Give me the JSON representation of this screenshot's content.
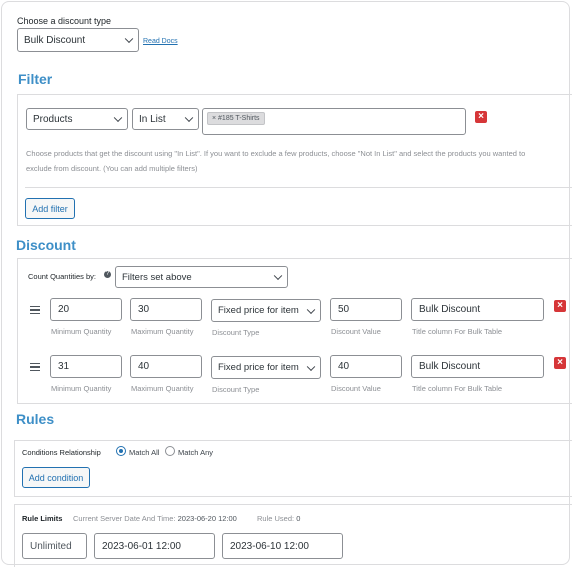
{
  "discount_type": {
    "label": "Choose a discount type",
    "selected": "Bulk Discount",
    "read_docs": "Read Docs"
  },
  "filter": {
    "heading": "Filter",
    "type": "Products",
    "method": "In List",
    "tag": "× #185 T-Shirts",
    "help_line1": "Choose products that get the discount using \"In List\". If you want to exclude a few products, choose \"Not In List\" and select the products you wanted to",
    "help_line2": "exclude from discount. (You can add multiple filters)",
    "add_label": "Add filter"
  },
  "discount": {
    "heading": "Discount",
    "count_label": "Count Quantities by:",
    "count_value": "Filters set above",
    "ranges": [
      {
        "min": "20",
        "max": "30",
        "type": "Fixed price for item",
        "value": "50",
        "title": "Bulk Discount"
      },
      {
        "min": "31",
        "max": "40",
        "type": "Fixed price for item",
        "value": "40",
        "title": "Bulk Discount"
      }
    ],
    "captions": {
      "min": "Minimum Quantity",
      "max": "Maximum Quantity",
      "type": "Discount Type",
      "value": "Discount Value",
      "title": "Title column For Bulk Table"
    }
  },
  "rules": {
    "heading": "Rules",
    "conditions_label": "Conditions Relationship",
    "match_all": "Match All",
    "match_any": "Match Any",
    "add_condition": "Add condition"
  },
  "limits": {
    "label": "Rule Limits",
    "server_label": "Current Server Date And Time:",
    "server_value": "2023-06-20 12:00",
    "used_label": "Rule Used:",
    "used_value": "0",
    "usage": "Unlimited",
    "start": "2023-06-01 12:00",
    "end": "2023-06-10 12:00"
  },
  "colors": {
    "accent": "#3e8fc7",
    "link": "#2271b1",
    "danger": "#d63638"
  }
}
